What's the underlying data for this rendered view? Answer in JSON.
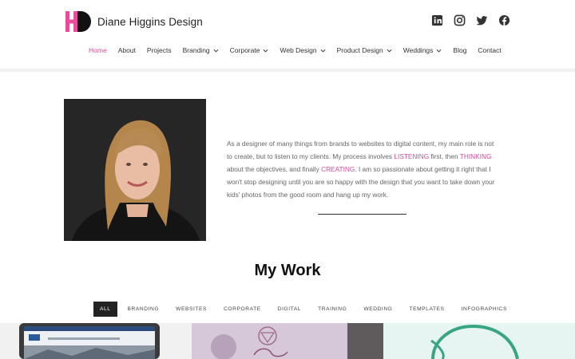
{
  "brand": {
    "name": "Diane Higgins Design",
    "accent": "#d64a9b"
  },
  "social": [
    {
      "icon": "linkedin-icon"
    },
    {
      "icon": "instagram-icon"
    },
    {
      "icon": "twitter-icon"
    },
    {
      "icon": "facebook-icon"
    }
  ],
  "nav": {
    "items": [
      {
        "label": "Home",
        "active": true,
        "dropdown": false
      },
      {
        "label": "About",
        "dropdown": false
      },
      {
        "label": "Projects",
        "dropdown": false
      },
      {
        "label": "Branding",
        "dropdown": true
      },
      {
        "label": "Corporate",
        "dropdown": true
      },
      {
        "label": "Web Design",
        "dropdown": true
      },
      {
        "label": "Product Design",
        "dropdown": true
      },
      {
        "label": "Weddings",
        "dropdown": true
      },
      {
        "label": "Blog",
        "dropdown": false
      },
      {
        "label": "Contact",
        "dropdown": false
      }
    ]
  },
  "bio": {
    "p1": "As a designer of many things from brands to websites to digital content, my main role is not to create, but to listen to my clients. My process involves ",
    "h1": "LISTENING",
    "p2": " first, then ",
    "h2": "THINKING",
    "p3": " about the objectives, and finally ",
    "h3": "CREATING.",
    "p4": " I am so passionate about getting it right that I won't stop designing until you are so happy with the design that you want to take down your kids' photos from the good room and hang up my work."
  },
  "work": {
    "title": "My Work",
    "filters": [
      "ALL",
      "BRANDING",
      "WEBSITES",
      "CORPORATE",
      "DIGITAL",
      "TRAINING",
      "WEDDING",
      "TEMPLATES",
      "INFOGRAPHICS"
    ],
    "active_filter": "ALL"
  }
}
